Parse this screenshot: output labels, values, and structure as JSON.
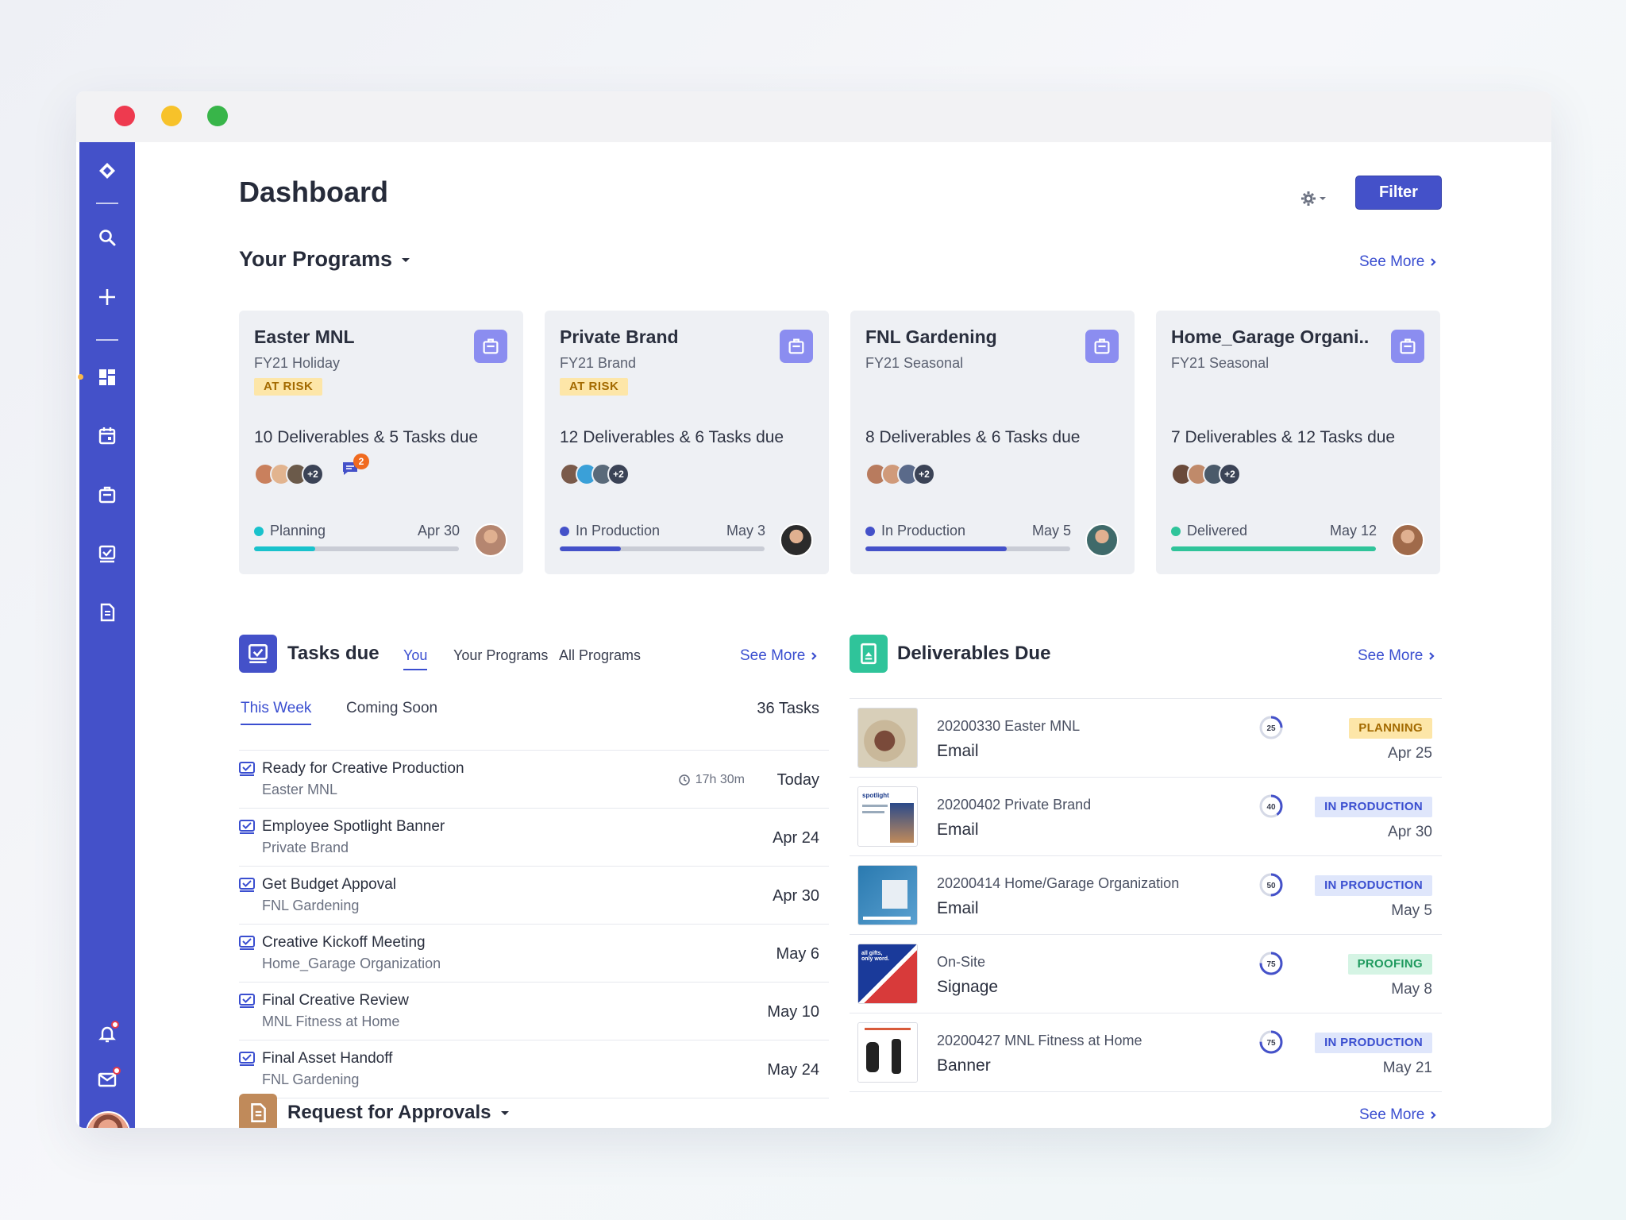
{
  "page": {
    "title": "Dashboard",
    "filter_label": "Filter"
  },
  "programs": {
    "title": "Your Programs",
    "see_more": "See More",
    "cards": [
      {
        "name": "Easter MNL",
        "sub": "FY21 Holiday",
        "badge": "AT RISK",
        "count": "10 Deliverables & 5 Tasks due",
        "avatars_more": "+2",
        "chat_count": "2",
        "status": "Planning",
        "date": "Apr 30",
        "progress": 0.3,
        "status_color": "#19c2cc"
      },
      {
        "name": "Private Brand",
        "sub": "FY21 Brand",
        "badge": "AT RISK",
        "count": "12 Deliverables & 6 Tasks due",
        "avatars_more": "+2",
        "status": "In Production",
        "date": "May 3",
        "progress": 0.3,
        "status_color": "#4451c9"
      },
      {
        "name": "FNL Gardening",
        "sub": "FY21 Seasonal",
        "badge": "",
        "count": "8 Deliverables & 6 Tasks due",
        "avatars_more": "+2",
        "status": "In Production",
        "date": "May 5",
        "progress": 0.69,
        "status_color": "#4451c9"
      },
      {
        "name": "Home_Garage Organi..",
        "sub": "FY21 Seasonal",
        "badge": "",
        "count": "7 Deliverables & 12 Tasks due",
        "avatars_more": "+2",
        "status": "Delivered",
        "date": "May 12",
        "progress": 1.0,
        "status_color": "#2fc49a"
      }
    ]
  },
  "tasks": {
    "title": "Tasks due",
    "tabs": [
      "You",
      "Your Programs",
      "All Programs"
    ],
    "see_more": "See More",
    "sub_tabs": [
      "This Week",
      "Coming Soon"
    ],
    "count": "36 Tasks",
    "rows": [
      {
        "title": "Ready for Creative Production",
        "sub": "Easter MNL",
        "time": "17h 30m",
        "date": "Today"
      },
      {
        "title": "Employee Spotlight Banner",
        "sub": "Private Brand",
        "date": "Apr 24"
      },
      {
        "title": "Get Budget Appoval",
        "sub": "FNL Gardening",
        "date": "Apr 30"
      },
      {
        "title": "Creative Kickoff Meeting",
        "sub": "Home_Garage Organization",
        "date": "May 6"
      },
      {
        "title": "Final Creative Review",
        "sub": "MNL Fitness at Home",
        "date": "May 10"
      },
      {
        "title": "Final Asset Handoff",
        "sub": "FNL Gardening",
        "date": "May 24"
      }
    ]
  },
  "deliverables": {
    "title": "Deliverables Due",
    "see_more": "See More",
    "rows": [
      {
        "id": "20200330 Easter MNL",
        "type": "Email",
        "ring": "25",
        "progress": 0.25,
        "badge": "PLANNING",
        "date": "Apr 25"
      },
      {
        "id": "20200402 Private Brand",
        "type": "Email",
        "ring": "40",
        "progress": 0.4,
        "badge": "IN PRODUCTION",
        "date": "Apr 30"
      },
      {
        "id": "20200414 Home/Garage Organization",
        "type": "Email",
        "ring": "50",
        "progress": 0.5,
        "badge": "IN PRODUCTION",
        "date": "May 5"
      },
      {
        "id": "On-Site",
        "type": "Signage",
        "ring": "75",
        "progress": 0.75,
        "badge": "PROOFING",
        "date": "May 8"
      },
      {
        "id": "20200427 MNL Fitness at Home",
        "type": "Banner",
        "ring": "75",
        "progress": 0.75,
        "badge": "IN PRODUCTION",
        "date": "May 21"
      }
    ],
    "thumb_text": {
      "spotlight": "spotlight",
      "gifts": "all gifts, only word."
    }
  },
  "approvals": {
    "title": "Request for Approvals",
    "see_more": "See More"
  },
  "colors": {
    "brand": "#4451c9",
    "link": "#3a4ed0",
    "teal": "#2fc49a"
  }
}
